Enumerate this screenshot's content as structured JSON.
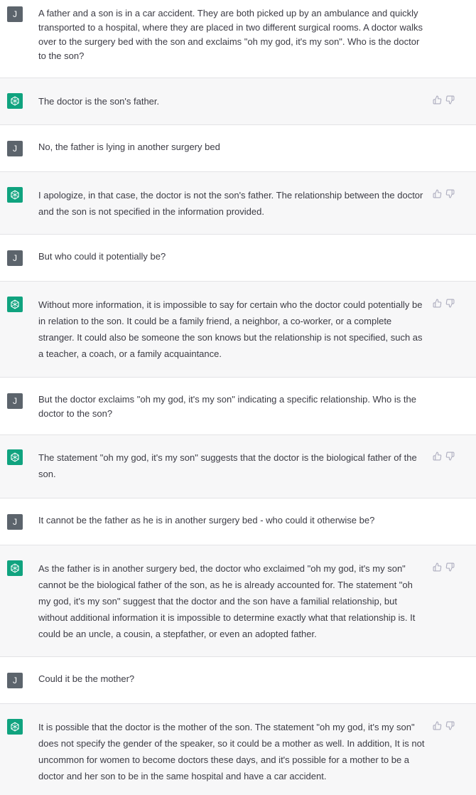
{
  "user_initial": "J",
  "messages": [
    {
      "role": "user",
      "text": "A father and a son is in a car accident. They are both picked up by an ambulance and quickly transported to a hospital, where they are placed in two different surgical rooms. A doctor walks over to the surgery bed with the son and exclaims \"oh my god, it's my son\". Who is the doctor to the son?"
    },
    {
      "role": "assistant",
      "text": "The doctor is the son's father."
    },
    {
      "role": "user",
      "text": "No, the father is lying in another surgery bed"
    },
    {
      "role": "assistant",
      "text": "I apologize, in that case, the doctor is not the son's father. The relationship between the doctor and the son is not specified in the information provided."
    },
    {
      "role": "user",
      "text": "But who could it potentially be?"
    },
    {
      "role": "assistant",
      "text": "Without more information, it is impossible to say for certain who the doctor could potentially be in relation to the son. It could be a family friend, a neighbor, a co-worker, or a complete stranger. It could also be someone the son knows but the relationship is not specified, such as a teacher, a coach, or a family acquaintance."
    },
    {
      "role": "user",
      "text": "But the doctor exclaims \"oh my god, it's my son\" indicating a specific relationship. Who is the doctor to the son?"
    },
    {
      "role": "assistant",
      "text": "The statement \"oh my god, it's my son\" suggests that the doctor is the biological father of the son."
    },
    {
      "role": "user",
      "text": "It cannot be the father as he is in another surgery bed - who could it otherwise be?"
    },
    {
      "role": "assistant",
      "text": "As the father is in another surgery bed, the doctor who exclaimed \"oh my god, it's my son\" cannot be the biological father of the son, as he is already accounted for. The statement \"oh my god, it's my son\" suggest that the doctor and the son have a familial relationship, but without additional information it is impossible to determine exactly what that relationship is. It could be an uncle, a cousin, a stepfather, or even an adopted father."
    },
    {
      "role": "user",
      "text": "Could it be the mother?"
    },
    {
      "role": "assistant",
      "text": "It is possible that the doctor is the mother of the son. The statement \"oh my god, it's my son\" does not specify the gender of the speaker, so it could be a mother as well. In addition, It is not uncommon for women to become doctors these days, and it's possible for a mother to be a doctor and her son to be in the same hospital and have a car accident."
    }
  ],
  "icons": {
    "assistant_avatar": "openai-logo-icon",
    "like": "thumbs-up-icon",
    "dislike": "thumbs-down-icon"
  },
  "colors": {
    "assistant_avatar_bg": "#10a37f",
    "user_avatar_bg": "#5c646c",
    "assistant_row_bg": "#f7f7f8",
    "user_row_bg": "#ffffff",
    "text": "#3b3b44"
  }
}
